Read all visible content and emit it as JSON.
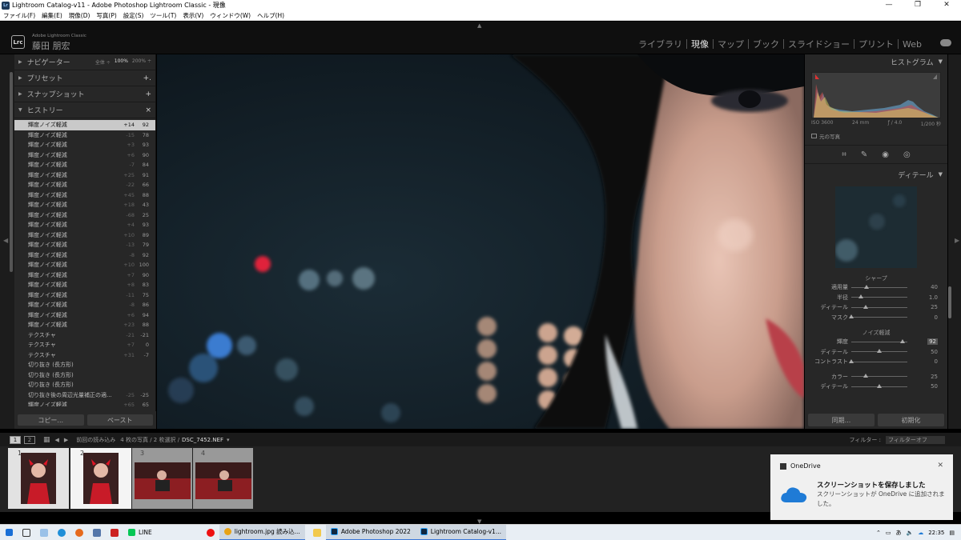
{
  "window": {
    "title": "Lightroom Catalog-v11 - Adobe Photoshop Lightroom Classic - 現像",
    "controls": [
      "—",
      "❐",
      "✕"
    ]
  },
  "menu": [
    "ファイル(F)",
    "編集(E)",
    "現像(D)",
    "写真(P)",
    "設定(S)",
    "ツール(T)",
    "表示(V)",
    "ウィンドウ(W)",
    "ヘルプ(H)"
  ],
  "header": {
    "logo": "Lrc",
    "product": "Adobe Lightroom Classic",
    "user": "藤田 朋宏",
    "modules": [
      "ライブラリ",
      "現像",
      "マップ",
      "ブック",
      "スライドショー",
      "プリント",
      "Web"
    ],
    "active_module": "現像"
  },
  "left": {
    "navigator": {
      "label": "ナビゲーター",
      "fit": "全体 ÷",
      "zoom1": "100%",
      "zoom2": "200% ÷"
    },
    "presets": {
      "label": "プリセット",
      "action": "+."
    },
    "snapshots": {
      "label": "スナップショット",
      "action": "+"
    },
    "history": {
      "label": "ヒストリー",
      "action": "×",
      "items": [
        {
          "name": "輝度ノイズ軽減",
          "delta": "+14",
          "value": "92",
          "selected": true
        },
        {
          "name": "輝度ノイズ軽減",
          "delta": "-15",
          "value": "78"
        },
        {
          "name": "輝度ノイズ軽減",
          "delta": "+3",
          "value": "93"
        },
        {
          "name": "輝度ノイズ軽減",
          "delta": "+6",
          "value": "90"
        },
        {
          "name": "輝度ノイズ軽減",
          "delta": "-7",
          "value": "84"
        },
        {
          "name": "輝度ノイズ軽減",
          "delta": "+25",
          "value": "91"
        },
        {
          "name": "輝度ノイズ軽減",
          "delta": "-22",
          "value": "66"
        },
        {
          "name": "輝度ノイズ軽減",
          "delta": "+45",
          "value": "88"
        },
        {
          "name": "輝度ノイズ軽減",
          "delta": "+18",
          "value": "43"
        },
        {
          "name": "輝度ノイズ軽減",
          "delta": "-68",
          "value": "25"
        },
        {
          "name": "輝度ノイズ軽減",
          "delta": "+4",
          "value": "93"
        },
        {
          "name": "輝度ノイズ軽減",
          "delta": "+10",
          "value": "89"
        },
        {
          "name": "輝度ノイズ軽減",
          "delta": "-13",
          "value": "79"
        },
        {
          "name": "輝度ノイズ軽減",
          "delta": "-8",
          "value": "92"
        },
        {
          "name": "輝度ノイズ軽減",
          "delta": "+10",
          "value": "100"
        },
        {
          "name": "輝度ノイズ軽減",
          "delta": "+7",
          "value": "90"
        },
        {
          "name": "輝度ノイズ軽減",
          "delta": "+8",
          "value": "83"
        },
        {
          "name": "輝度ノイズ軽減",
          "delta": "-11",
          "value": "75"
        },
        {
          "name": "輝度ノイズ軽減",
          "delta": "-8",
          "value": "86"
        },
        {
          "name": "輝度ノイズ軽減",
          "delta": "+6",
          "value": "94"
        },
        {
          "name": "輝度ノイズ軽減",
          "delta": "+23",
          "value": "88"
        },
        {
          "name": "テクスチャ",
          "delta": "-21",
          "value": "-21"
        },
        {
          "name": "テクスチャ",
          "delta": "+7",
          "value": "0"
        },
        {
          "name": "テクスチャ",
          "delta": "+31",
          "value": "-7"
        },
        {
          "name": "切り抜き (長方形)",
          "delta": "",
          "value": ""
        },
        {
          "name": "切り抜き (長方形)",
          "delta": "",
          "value": ""
        },
        {
          "name": "切り抜き (長方形)",
          "delta": "",
          "value": ""
        },
        {
          "name": "切り抜き後の周辺光量補正の適...",
          "delta": "-25",
          "value": "-25"
        },
        {
          "name": "輝度ノイズ軽減",
          "delta": "+65",
          "value": "65"
        }
      ]
    },
    "copy_button": "コピー...",
    "paste_button": "ペースト"
  },
  "right": {
    "histogram": {
      "label": "ヒストグラム",
      "iso": "ISO 3600",
      "focal": "24 mm",
      "aperture": "ƒ / 4.0",
      "shutter": "1/200 秒",
      "original_photo": "元の写真"
    },
    "detail": {
      "label": "ディテール",
      "sharpen_title": "シャープ",
      "sharpen": [
        {
          "label": "適用量",
          "value": "40",
          "pos": 0.27
        },
        {
          "label": "半径",
          "value": "1.0",
          "pos": 0.17
        },
        {
          "label": "ディテール",
          "value": "25",
          "pos": 0.25
        },
        {
          "label": "マスク",
          "value": "0",
          "pos": 0.0
        }
      ],
      "noise_title": "ノイズ軽減",
      "noise": [
        {
          "label": "輝度",
          "value": "92",
          "pos": 0.92,
          "hl": true
        },
        {
          "label": "ディテール",
          "value": "50",
          "pos": 0.5
        },
        {
          "label": "コントラスト",
          "value": "0",
          "pos": 0.0
        }
      ],
      "color": [
        {
          "label": "カラー",
          "value": "25",
          "pos": 0.25
        },
        {
          "label": "ディテール",
          "value": "50",
          "pos": 0.5
        }
      ]
    },
    "sync_button": "同期...",
    "reset_button": "初期化"
  },
  "filmbar": {
    "pages": [
      "1",
      "2"
    ],
    "source": "前回の読み込み",
    "count": "4 枚の写真 / 2 枚選択 /",
    "filename": "DSC_7452.NEF",
    "filter_label": "フィルター :",
    "filter_value": "フィルターオフ"
  },
  "thumbs": [
    "1",
    "2",
    "3",
    "4"
  ],
  "toast": {
    "app": "OneDrive",
    "title": "スクリーンショットを保存しました",
    "body": "スクリーンショットが OneDrive に追加されました。"
  },
  "taskbar": {
    "line": "LINE",
    "chrome": "lightroom.jpg 読み込...",
    "photoshop": "Adobe Photoshop 2022",
    "lightroom": "Lightroom Catalog-v1...",
    "time": "22:35"
  }
}
